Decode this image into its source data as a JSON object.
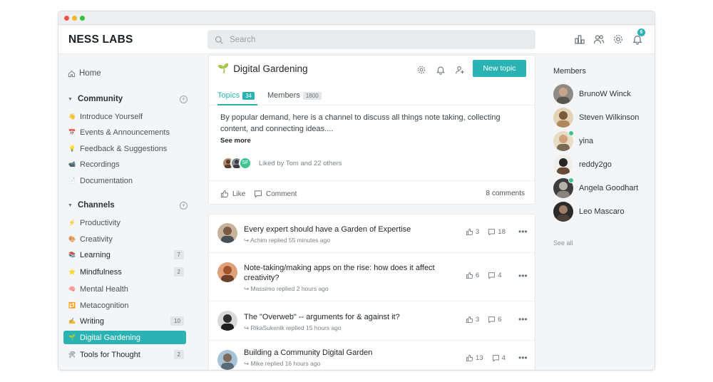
{
  "window": {
    "controls": [
      "close",
      "minimize",
      "maximize"
    ]
  },
  "brand": "NESS LABS",
  "search": {
    "placeholder": "Search"
  },
  "header_icons": [
    "leaderboard-icon",
    "people-icon",
    "gear-icon",
    "bell-icon"
  ],
  "notifications": {
    "count": "6"
  },
  "sidebar": {
    "home": "Home",
    "community": {
      "title": "Community",
      "items": [
        {
          "emoji": "👋",
          "label": "Introduce Yourself"
        },
        {
          "emoji": "📅",
          "label": "Events & Announcements"
        },
        {
          "emoji": "💡",
          "label": "Feedback & Suggestions"
        },
        {
          "emoji": "📹",
          "label": "Recordings"
        },
        {
          "emoji": "📄",
          "label": "Documentation"
        }
      ]
    },
    "channels": {
      "title": "Channels",
      "items": [
        {
          "emoji": "⚡",
          "label": "Productivity",
          "count": ""
        },
        {
          "emoji": "🎨",
          "label": "Creativity",
          "count": ""
        },
        {
          "emoji": "📚",
          "label": "Learning",
          "count": "7"
        },
        {
          "emoji": "⭐",
          "label": "Mindfulness",
          "count": "2"
        },
        {
          "emoji": "🧠",
          "label": "Mental Health",
          "count": ""
        },
        {
          "emoji": "🔁",
          "label": "Metacognition",
          "count": ""
        },
        {
          "emoji": "✍",
          "label": "Writing",
          "count": "10"
        },
        {
          "emoji": "🌱",
          "label": "Digital Gardening",
          "count": ""
        },
        {
          "emoji": "🛠",
          "label": "Tools for Thought",
          "count": "2"
        }
      ]
    }
  },
  "channel": {
    "icon": "🌱",
    "title": "Digital Gardening",
    "new_topic": "New topic",
    "tabs": [
      {
        "label": "Topics",
        "count": "34"
      },
      {
        "label": "Members",
        "count": "1800"
      }
    ],
    "description": "By popular demand, here is a channel to discuss all things note taking, collecting content, and connecting ideas....",
    "see_more": "See more",
    "liked_by": "Liked by Tom and 22 others",
    "liker_initials": "SF",
    "like_label": "Like",
    "comment_label": "Comment",
    "comments": "8 comments"
  },
  "posts": [
    {
      "title": "Every expert should have a Garden of Expertise",
      "meta": "Achim replied 55 minutes ago",
      "likes": "3",
      "comments": "18"
    },
    {
      "title": "Note-taking/making apps on the rise: how does it affect creativity?",
      "meta": "Massimo replied 2 hours ago",
      "likes": "6",
      "comments": "4"
    },
    {
      "title": "The \"Overweb\" -- arguments for & against it?",
      "meta": "RikaSukenik replied 15 hours ago",
      "likes": "3",
      "comments": "6"
    },
    {
      "title": "Building a Community Digital Garden",
      "meta": "Mike replied 16 hours ago",
      "likes": "13",
      "comments": "4"
    }
  ],
  "members": {
    "title": "Members",
    "list": [
      {
        "name": "BrunoW Winck",
        "online": false
      },
      {
        "name": "Steven Wilkinson",
        "online": false
      },
      {
        "name": "yina",
        "online": true
      },
      {
        "name": "reddy2go",
        "online": false
      },
      {
        "name": "Angela Goodhart",
        "online": true
      },
      {
        "name": "Leo Mascaro",
        "online": false
      }
    ],
    "see_all": "See all"
  },
  "colors": {
    "accent": "#2bb3b3",
    "online": "#3ec48f"
  }
}
